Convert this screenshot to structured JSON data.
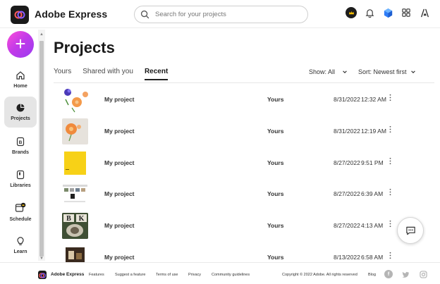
{
  "header": {
    "brand": "Adobe Express",
    "search_placeholder": "Search for your projects"
  },
  "sidebar": {
    "items": [
      {
        "label": "Home",
        "icon": "home-icon"
      },
      {
        "label": "Projects",
        "icon": "projects-icon"
      },
      {
        "label": "Brands",
        "icon": "brands-icon"
      },
      {
        "label": "Libraries",
        "icon": "libraries-icon"
      },
      {
        "label": "Schedule",
        "icon": "schedule-icon"
      },
      {
        "label": "Learn",
        "icon": "learn-icon"
      }
    ]
  },
  "main": {
    "title": "Projects",
    "tabs": [
      "Yours",
      "Shared with you",
      "Recent"
    ],
    "show_filter": "Show: All",
    "sort_filter": "Sort: Newest first"
  },
  "projects": [
    {
      "name": "My project",
      "owner": "Yours",
      "date": "8/31/2022",
      "time": "12:32 AM"
    },
    {
      "name": "My project",
      "owner": "Yours",
      "date": "8/31/2022",
      "time": "12:19 AM"
    },
    {
      "name": "My project",
      "owner": "Yours",
      "date": "8/27/2022",
      "time": "9:51 PM"
    },
    {
      "name": "My project",
      "owner": "Yours",
      "date": "8/27/2022",
      "time": "6:39 AM"
    },
    {
      "name": "My project",
      "owner": "Yours",
      "date": "8/27/2022",
      "time": "4:13 AM"
    },
    {
      "name": "My project",
      "owner": "Yours",
      "date": "8/13/2022",
      "time": "6:58 AM"
    }
  ],
  "thumb_letters": [
    "B",
    "K"
  ],
  "footer": {
    "brand": "Adobe Express",
    "links": [
      "Features",
      "Suggest a feature",
      "Terms of use",
      "Privacy",
      "Community guidelines"
    ],
    "copyright": "Copyright © 2022 Adobe. All rights reserved",
    "blog": "Blog"
  },
  "colors": {
    "accent": "#c43ae8",
    "sidebar_active": "#e5e5e5"
  }
}
